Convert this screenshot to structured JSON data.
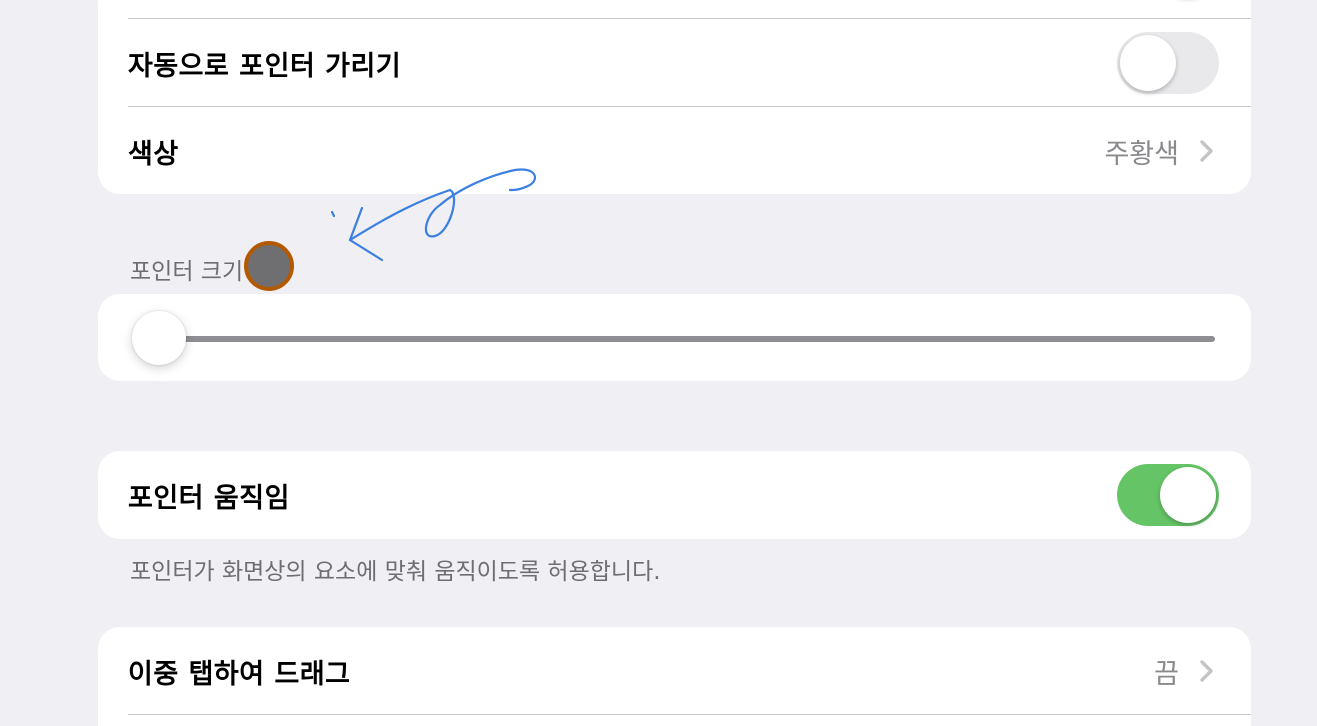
{
  "pointer_settings": {
    "auto_hide": {
      "label": "자동으로 포인터 가리기",
      "enabled": false
    },
    "color": {
      "label": "색상",
      "value": "주황색"
    }
  },
  "pointer_size": {
    "header": "포인터 크기",
    "slider_value": 0.0
  },
  "pointer_animation": {
    "label": "포인터 움직임",
    "enabled": true,
    "footer": "포인터가 화면상의 요소에 맞춰 움직이도록 허용합니다."
  },
  "double_tap_drag": {
    "label": "이중 탭하여 드래그",
    "value": "끔"
  },
  "colors": {
    "toggle_on": "#65c466",
    "toggle_off": "#e9e9eb",
    "pointer_fill": "#6f6f72",
    "pointer_border": "#b35a00",
    "annotation_ink": "#3b7fe0"
  }
}
